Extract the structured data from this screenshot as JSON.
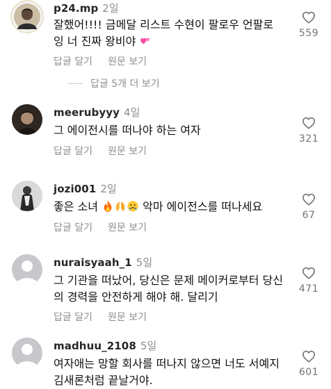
{
  "actions": {
    "reply": "답글 달기",
    "see_original": "원문 보기"
  },
  "comments": [
    {
      "username": "p24.mp",
      "time": "2일",
      "text": "잘했어!!!! 금메달 리스트 수현이 팔로우 언팔로잉 너 진짜 왕비야 ",
      "likes": "559"
    },
    {
      "username": "meerubyyy",
      "time": "4일",
      "text": "그 에이전시를 떠나야 하는 여자",
      "likes": "321"
    },
    {
      "username": "jozi001",
      "time": "2일",
      "text_before": "좋은 소녀 ",
      "text_after": " 악마 에이전스를 떠나세요",
      "likes": "67"
    },
    {
      "username": "nuraisyaah_1",
      "time": "5일",
      "text": "그 기관을 떠났어, 당신은 문제 메이커로부터 당신의 경력을 안전하게 해야 해. 달리기",
      "likes": "471"
    },
    {
      "username": "madhuu_2108",
      "time": "5일",
      "text": "여자애는 망할 회사를 떠나지 않으면 너도 서예지 김새론처럼 끝날거야.",
      "likes": "601"
    }
  ],
  "view_more_replies": "답글 5개 더 보기",
  "icons": {
    "like": "heart-outline-icon",
    "default_avatar": "default-profile-icon",
    "emoji_1": "two-hearts-emoji",
    "emoji_2": "fire-emoji",
    "emoji_3": "raising-hands-emoji",
    "emoji_4": "crying-face-emoji"
  },
  "colors": {
    "muted_text": "#8e8e8e",
    "default_avatar_bg": "#c7c7cc",
    "emoji_pink": "#ff4fa3"
  }
}
